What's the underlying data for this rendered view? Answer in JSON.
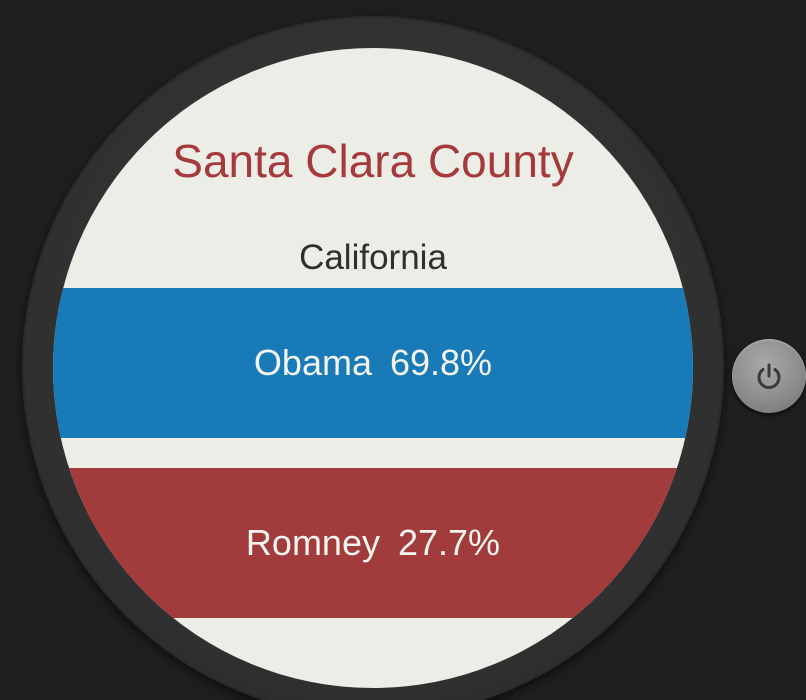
{
  "county": "Santa Clara County",
  "state": "California",
  "results": [
    {
      "candidate": "Obama",
      "percent": "69.8%",
      "color": "#187bb7"
    },
    {
      "candidate": "Romney",
      "percent": "27.7%",
      "color": "#a13b3c"
    }
  ],
  "colors": {
    "background": "#1f1f1f",
    "face": "#edede7",
    "title": "#a53a3d"
  },
  "icons": {
    "power": "power-icon"
  }
}
